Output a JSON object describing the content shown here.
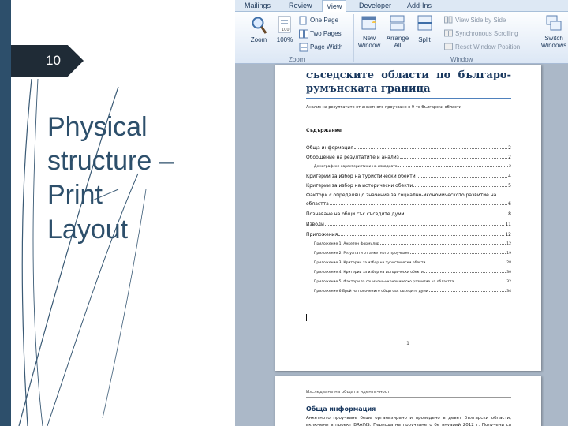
{
  "slide": {
    "number": "10",
    "title_lines": [
      "Physical",
      "structure –",
      "Print",
      "Layout"
    ],
    "colors": {
      "accent": "#2d4f6b",
      "number_bg": "#1f2b36"
    }
  },
  "word": {
    "tabs": [
      "Mailings",
      "Review",
      "View",
      "Developer",
      "Add-Ins"
    ],
    "active_tab": "View",
    "zoom_group": {
      "label": "Zoom",
      "zoom": "Zoom",
      "hundred": "100%",
      "one_page": "One Page",
      "two_pages": "Two Pages",
      "page_width": "Page Width"
    },
    "window_group": {
      "label": "Window",
      "new_window": [
        "New",
        "Window"
      ],
      "arrange_all": [
        "Arrange",
        "All"
      ],
      "split": "Split",
      "view_side_by_side": "View Side by Side",
      "synchronous_scrolling": "Synchronous Scrolling",
      "reset_window_position": "Reset Window Position",
      "switch_windows": [
        "Switch",
        "Windows"
      ]
    },
    "page1": {
      "heading_lines": [
        "съседските области по българо-",
        "румънската граница"
      ],
      "subtitle": "Анализ на резултатите от анкетното проучване в 9-те български области",
      "toc_heading": "Съдържание",
      "toc": [
        {
          "title": "Обща информация",
          "page": "2"
        },
        {
          "title": "Обобщение на резултатите и анализ",
          "page": "2"
        },
        {
          "title": "Демографски характеристики на извадката",
          "page": "2"
        },
        {
          "title": "Критерии за избор на туристически обекти",
          "page": "4"
        },
        {
          "title": "Критерии за избор на исторически обекти",
          "page": "5"
        },
        {
          "title_first": "Фактори с определящо значение за социално-икономическото развитие на",
          "title": "областта",
          "page": "6"
        },
        {
          "title": "Познаване на общи със съседите думи",
          "page": "8"
        },
        {
          "title": "Изводи",
          "page": "11"
        },
        {
          "title": "Приложения",
          "page": "12"
        },
        {
          "title": "Приложение 1. Анкетен формуляр",
          "page": "12"
        },
        {
          "title": "Приложение 2. Резултати от анкетното проучване",
          "page": "19"
        },
        {
          "title": "Приложение 3. Критерии за избор на туристически обекти",
          "page": "28"
        },
        {
          "title": "Приложение 4. Критерии за избор на исторически обекти",
          "page": "30"
        },
        {
          "title": "Приложение 5. Фактори за социално-икономическо развитие на областта",
          "page": "32"
        },
        {
          "title": "Приложение 6 Брой на посочените общи със съседите думи",
          "page": "34"
        }
      ],
      "page_number": "1"
    },
    "page2": {
      "header": "Изследване на общата идентичност",
      "heading": "Обща информация",
      "text": "Анкетното проучване беше организирано и проведено в девет български области, включени в проект BRAINS. Периода на проучването бе януарий 2012 г. Получени са общо 280 отговора с"
    },
    "colors": {
      "workspace": "#abb8c8",
      "heading": "#17365d",
      "rule": "#4f81bd"
    }
  }
}
